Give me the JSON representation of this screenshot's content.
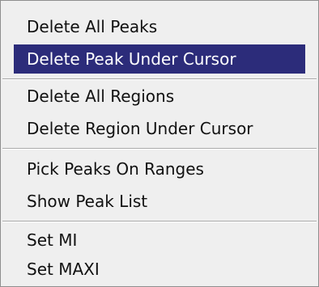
{
  "menu": {
    "highlight_color": "#2c2c7a",
    "items": [
      {
        "label": "Delete All Peaks"
      },
      {
        "label": "Delete Peak Under Cursor",
        "highlighted": true
      },
      {
        "label": "Delete All Regions"
      },
      {
        "label": "Delete Region Under Cursor"
      },
      {
        "label": "Pick Peaks On Ranges"
      },
      {
        "label": "Show Peak List"
      },
      {
        "label": "Set MI"
      },
      {
        "label": "Set MAXI"
      }
    ]
  }
}
